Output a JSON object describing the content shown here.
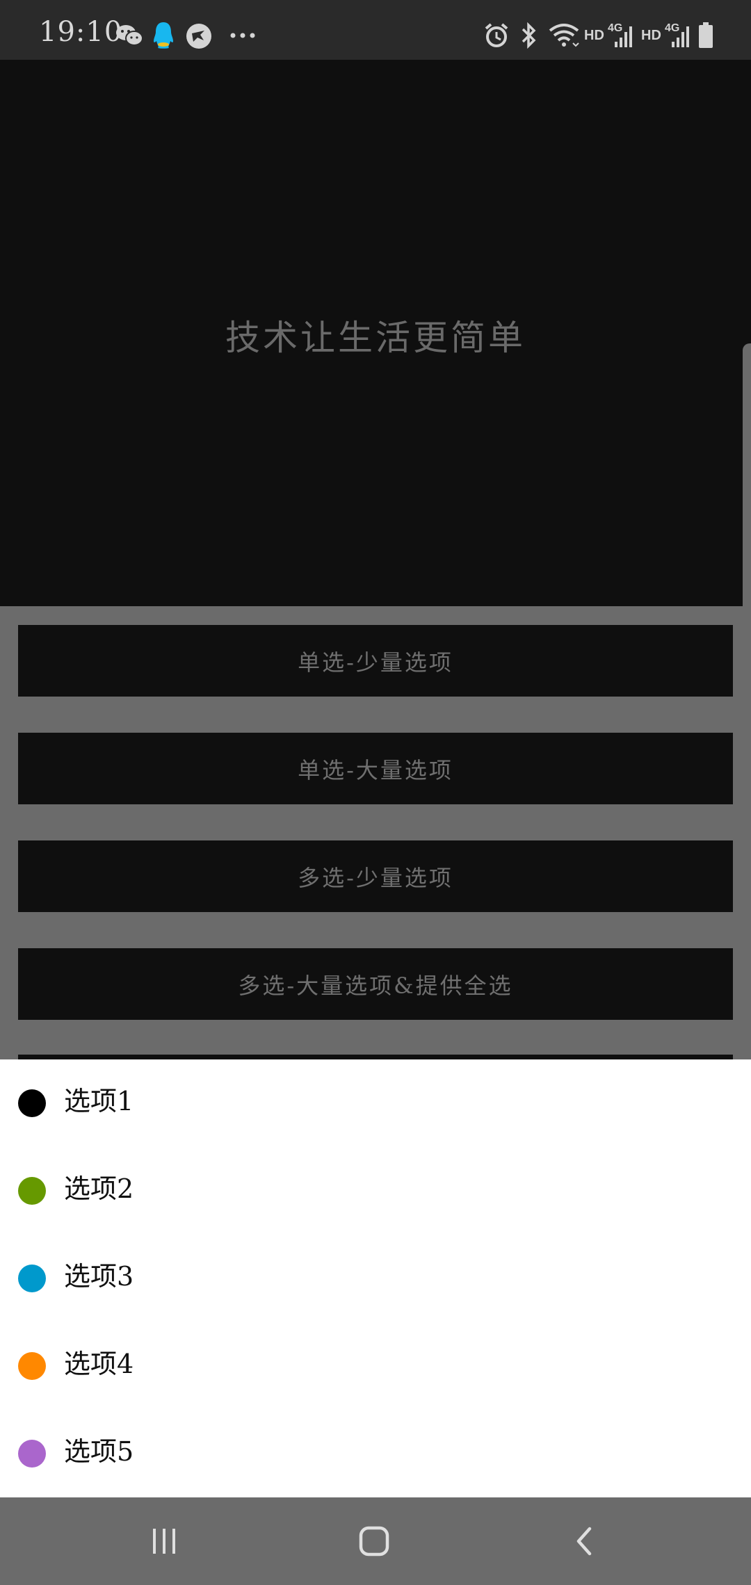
{
  "status_bar": {
    "time": "19:10",
    "icons_left": [
      "wechat-icon",
      "qq-icon",
      "app-bird-icon",
      "more-dots-icon"
    ],
    "icons_right": [
      "alarm-icon",
      "bluetooth-icon",
      "wifi-icon",
      "hd-label",
      "signal-4g-icon",
      "hd-label",
      "signal-4g-icon",
      "battery-icon"
    ],
    "hd_label": "HD",
    "network_label": "4G"
  },
  "hero": {
    "title": "技术让生活更简单"
  },
  "buttons": [
    {
      "label": "单选-少量选项"
    },
    {
      "label": "单选-大量选项"
    },
    {
      "label": "多选-少量选项"
    },
    {
      "label": "多选-大量选项&提供全选"
    }
  ],
  "sheet": {
    "items": [
      {
        "label": "选项1",
        "color": "#000000"
      },
      {
        "label": "选项2",
        "color": "#669900"
      },
      {
        "label": "选项3",
        "color": "#0099cc"
      },
      {
        "label": "选项4",
        "color": "#ff8800"
      },
      {
        "label": "选项5",
        "color": "#aa66cc"
      }
    ]
  },
  "nav_bar": {
    "buttons": [
      "recent-apps-icon",
      "home-icon",
      "back-icon"
    ]
  }
}
